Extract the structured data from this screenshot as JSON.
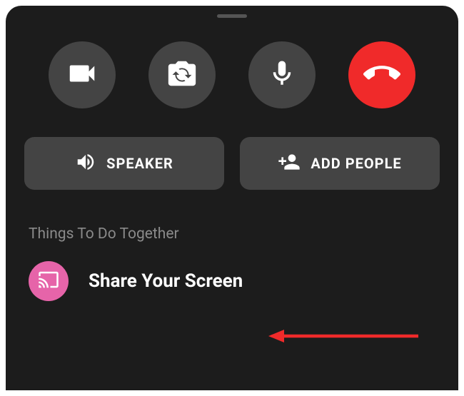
{
  "buttons": {
    "speaker": "SPEAKER",
    "add_people": "ADD PEOPLE"
  },
  "section": {
    "heading": "Things To Do Together"
  },
  "list": {
    "share_screen": "Share Your Screen"
  },
  "colors": {
    "end_call": "#f02a2a",
    "share_icon_bg": "#e664a9",
    "panel_bg": "#1c1c1c",
    "button_bg": "#444444"
  }
}
